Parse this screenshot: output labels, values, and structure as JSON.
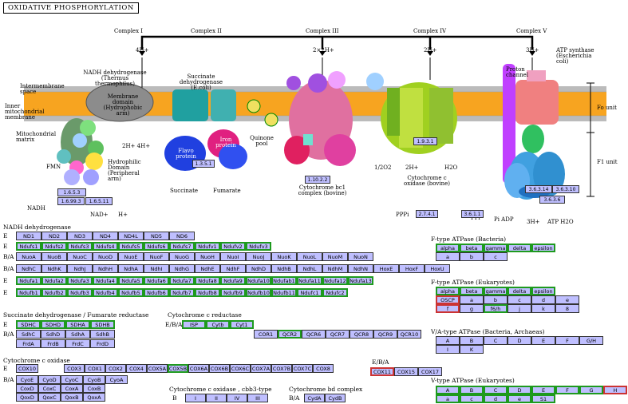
{
  "title": "OXIDATIVE PHOSPHORYLATION",
  "complex_headers": [
    "Complex I",
    "Complex II",
    "Complex III",
    "Complex IV",
    "Complex V"
  ],
  "diagram_labels": {
    "intermembrane": "Intermembrane space",
    "inner": "Inner mitochondrial membrane",
    "matrix": "Mitochondrial matrix",
    "nadh_dh": "NADH dehydrogenase (Thermus thermophilus)",
    "membrane_domain": "Membrane domain (Hydrophobic arm)",
    "hydrophilic": "Hydrophilic Domain (Peripheral arm)",
    "sdh": "Succinate dehydrogenase (E.coli)",
    "flavo": "Flavo protein",
    "iron": "Iron protein",
    "quinone_pool": "Quinone pool",
    "cytbc1": "Cytochrome bc1 complex (bovine)",
    "cytox": "Cytochrome c oxidase (bovine)",
    "atp_synthase": "ATP synthase (Escherichia coli)",
    "proton_channel": "Proton channel",
    "fo": "Fo unit",
    "f1": "F1 unit",
    "fmn": "FMN",
    "h4_1": "4H+",
    "h4_2": "2H+ 4H+",
    "h_3": "2×2H+",
    "h_4": "2H+",
    "h_5": "3H+",
    "o2": "1/2O2",
    "h2_4": "2H+",
    "h2o": "H2O",
    "succinate": "Succinate",
    "fumarate": "Fumarate",
    "nadh": "NADH",
    "nad": "NAD+",
    "hplus": "H+",
    "pppi": "PPPi",
    "ppi": "PPi",
    "piadp": "Pi ADP",
    "h3b": "3H+",
    "atph2o": "ATP H2O"
  },
  "ec_numbers": {
    "e1": "1.6.5.3",
    "e2": "1.6.99.3",
    "e3": "1.6.5.11",
    "e4": "1.3.5.1",
    "e5": "1.10.2.2",
    "e6": "1.9.3.1",
    "e7": "3.6.3.14",
    "e8": "3.6.3.10",
    "e9": "3.6.3.6",
    "e10": "2.7.4.1",
    "e11": "3.6.1.1"
  },
  "sections": {
    "nadh": "NADH dehydrogenase",
    "succ": "Succinate dehydrogenase / Fumarate reductase",
    "cytc_red": "Cytochrome c reductase",
    "cox": "Cytochrome c oxidase",
    "cbb3": "Cytochrome c oxidase , cbb3-type",
    "bd": "Cytochrome bd complex",
    "ftype_bac": "F-type ATPase (Bacteria)",
    "ftype_euk": "F-type ATPase (Eukaryotes)",
    "va": "V/A-type ATPase (Bacteria, Archaeas)",
    "vtype": "V-type ATPase (Eukaryotes)"
  },
  "nadh_rows": [
    {
      "label": "E",
      "items": [
        [
          "ND1",
          0
        ],
        [
          "ND2",
          0
        ],
        [
          "ND3",
          0
        ],
        [
          "ND4",
          0
        ],
        [
          "ND4L",
          0
        ],
        [
          "ND5",
          0
        ],
        [
          "ND6",
          0
        ]
      ]
    },
    {
      "label": "E",
      "items": [
        [
          "Ndufs1",
          1
        ],
        [
          "Ndufs2",
          1
        ],
        [
          "Ndufs3",
          1
        ],
        [
          "Ndufs4",
          1
        ],
        [
          "Ndufs5",
          1
        ],
        [
          "Ndufs6",
          1
        ],
        [
          "Ndufs7",
          1
        ],
        [
          "Ndufv1",
          1
        ],
        [
          "Ndufv2",
          1
        ],
        [
          "Ndufv3",
          1
        ]
      ]
    },
    {
      "label": "B/A",
      "items": [
        [
          "NuoA",
          0
        ],
        [
          "NuoB",
          0
        ],
        [
          "NuoC",
          0
        ],
        [
          "NuoD",
          0
        ],
        [
          "NuoE",
          0
        ],
        [
          "NuoF",
          0
        ],
        [
          "NuoG",
          0
        ],
        [
          "NuoH",
          0
        ],
        [
          "NuoI",
          0
        ],
        [
          "NuoJ",
          0
        ],
        [
          "NuoK",
          0
        ],
        [
          "NuoL",
          0
        ],
        [
          "NuoM",
          0
        ],
        [
          "NuoN",
          0
        ]
      ]
    },
    {
      "label": "B/A",
      "items": [
        [
          "NdhC",
          0
        ],
        [
          "NdhK",
          0
        ],
        [
          "NdhJ",
          0
        ],
        [
          "NdhH",
          0
        ],
        [
          "NdhA",
          0
        ],
        [
          "NdhI",
          0
        ],
        [
          "NdhG",
          0
        ],
        [
          "NdhE",
          0
        ],
        [
          "NdhF",
          0
        ],
        [
          "NdhD",
          0
        ],
        [
          "NdhB",
          0
        ],
        [
          "NdhL",
          0
        ],
        [
          "NdhM",
          0
        ],
        [
          "NdhN",
          0
        ],
        [
          "HoxE",
          0
        ],
        [
          "HoxF",
          0
        ],
        [
          "HoxU",
          0
        ]
      ]
    },
    {
      "label": "E",
      "items": [
        [
          "Ndufa1",
          1
        ],
        [
          "Ndufa2",
          1
        ],
        [
          "Ndufa3",
          1
        ],
        [
          "Ndufa4",
          1
        ],
        [
          "Ndufa5",
          1
        ],
        [
          "Ndufa6",
          1
        ],
        [
          "Ndufa7",
          1
        ],
        [
          "Ndufa8",
          1
        ],
        [
          "Ndufa9",
          1
        ],
        [
          "Ndufa10",
          1
        ],
        [
          "Ndufab1",
          1
        ],
        [
          "Ndufa11",
          1
        ],
        [
          "Ndufa12",
          1
        ],
        [
          "Ndufa13",
          1
        ]
      ]
    },
    {
      "label": "E",
      "items": [
        [
          "Ndufb1",
          1
        ],
        [
          "Ndufb2",
          1
        ],
        [
          "Ndufb3",
          1
        ],
        [
          "Ndufb4",
          1
        ],
        [
          "Ndufb5",
          1
        ],
        [
          "Ndufb6",
          1
        ],
        [
          "Ndufb7",
          1
        ],
        [
          "Ndufb8",
          1
        ],
        [
          "Ndufb9",
          1
        ],
        [
          "Ndufb10",
          1
        ],
        [
          "Ndufb11",
          1
        ],
        [
          "Ndufc1",
          1
        ],
        [
          "Ndufc2",
          1
        ]
      ]
    }
  ],
  "succ_rows": [
    {
      "label": "E",
      "items": [
        [
          "SDHC",
          1
        ],
        [
          "SDHD",
          1
        ],
        [
          "SDHA",
          1
        ],
        [
          "SDHB",
          1
        ]
      ]
    },
    {
      "label": "B/A",
      "items": [
        [
          "SdhC",
          0
        ],
        [
          "SdhD",
          0
        ],
        [
          "SdhA",
          0
        ],
        [
          "SdhB",
          0
        ]
      ]
    },
    {
      "label": "",
      "items": [
        [
          "FrdA",
          0
        ],
        [
          "FrdB",
          0
        ],
        [
          "FrdC",
          0
        ],
        [
          "FrdD",
          0
        ]
      ]
    }
  ],
  "cytc_rows": [
    {
      "label": "E/B/A",
      "items": [
        [
          "ISP",
          1
        ],
        [
          "Cytb",
          1
        ],
        [
          "Cyt1",
          1
        ]
      ]
    },
    {
      "label": "",
      "items": [
        [
          "COR1",
          0
        ],
        [
          "QCR2",
          1
        ],
        [
          "QCR6",
          0
        ],
        [
          "QCR7",
          0
        ],
        [
          "QCR8",
          0
        ],
        [
          "QCR9",
          0
        ],
        [
          "QCR10",
          0
        ]
      ]
    }
  ],
  "cox_rows": [
    {
      "label": "E",
      "items": [
        [
          "COX10",
          0
        ]
      ]
    },
    {
      "label": "",
      "items": [
        [
          "COX3",
          0
        ],
        [
          "COX1",
          0
        ],
        [
          "COX2",
          0
        ],
        [
          "COX4",
          0
        ],
        [
          "COX5A",
          0
        ],
        [
          "COX5B",
          1
        ],
        [
          "COX6A",
          0
        ],
        [
          "COX6B",
          0
        ],
        [
          "COX6C",
          0
        ],
        [
          "COX7A",
          0
        ],
        [
          "COX7B",
          0
        ],
        [
          "COX7C",
          0
        ],
        [
          "COX8",
          0
        ]
      ]
    },
    {
      "label": "B/A",
      "items": [
        [
          "CyoE",
          0
        ],
        [
          "CyoD",
          0
        ],
        [
          "CyoC",
          0
        ],
        [
          "CyoB",
          0
        ],
        [
          "CyoA",
          0
        ]
      ]
    },
    {
      "label": "",
      "items": [
        [
          "CoxD",
          0
        ],
        [
          "CoxC",
          0
        ],
        [
          "CoxA",
          0
        ],
        [
          "CoxB",
          0
        ]
      ]
    },
    {
      "label": "",
      "items": [
        [
          "QoxD",
          0
        ],
        [
          "QoxC",
          0
        ],
        [
          "QoxB",
          0
        ],
        [
          "QoxA",
          0
        ]
      ]
    }
  ],
  "cox_eba": "E/B/A",
  "cox_extra": [
    [
      "COX11",
      2
    ],
    [
      "COX15",
      0
    ],
    [
      "COX17",
      0
    ]
  ],
  "cbb3": {
    "label": "B",
    "items": [
      "I",
      "II",
      "IV",
      "III"
    ]
  },
  "bd": {
    "label": "B/A",
    "items": [
      "CydA",
      "CydB"
    ]
  },
  "ftype_bac": [
    [
      "alpha",
      "beta",
      "gamma",
      "delta",
      "epsilon"
    ],
    [
      "a",
      "b",
      "c"
    ]
  ],
  "ftype_euk": [
    [
      "alpha",
      "beta",
      "gamma",
      "delta",
      "epsilon"
    ],
    [
      "OSCP",
      "a",
      "b",
      "c",
      "d",
      "e"
    ],
    [
      "f",
      "g",
      "f6/h",
      "j",
      "k",
      "8"
    ]
  ],
  "va": [
    [
      "A",
      "B",
      "C",
      "D",
      "E",
      "F",
      "G/H"
    ],
    [
      "I",
      "K"
    ]
  ],
  "vtype": [
    [
      "A",
      "B",
      "C",
      "D",
      "E",
      "F",
      "G",
      "H"
    ],
    [
      "a",
      "c",
      "d",
      "e",
      "S1"
    ]
  ]
}
